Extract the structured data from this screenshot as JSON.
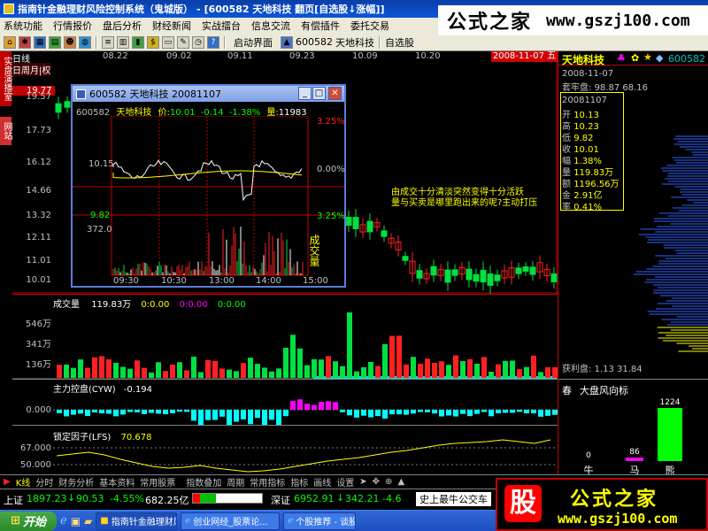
{
  "app": {
    "title": "指南针金融理财风险控制系统（鬼城版）",
    "title_sep": "-",
    "title_detail": "[600582 天地科技 翻页[自选股↓涨幅]]"
  },
  "watermark": {
    "cn": "公式之家",
    "url": "www.gszj100.com",
    "bottom_icon": "股"
  },
  "menu": [
    "系统功能",
    "行情报价",
    "盘后分析",
    "财经新闻",
    "实战擂台",
    "信息交流",
    "有偿插件",
    "委托交易"
  ],
  "toolbar": {
    "launch_label": "启动界面",
    "stock_code": "600582",
    "stock_name": "天地科技",
    "watchlist": "自选股"
  },
  "date_axis": {
    "labels": [
      "08.22",
      "09.02",
      "09.11",
      "09.23",
      "10.09",
      "10.20"
    ],
    "current_date": "2008-11-07",
    "current_day": "五"
  },
  "left_tabs": {
    "practice": "实盘演播室",
    "site": "网站"
  },
  "price_pane": {
    "period_label": "日线",
    "period_switch": "日周月|权",
    "highlight_price": "19.77",
    "price_ticks": [
      "19.57",
      "17.73",
      "16.12",
      "14.66",
      "13.32",
      "12.11",
      "11.01",
      "10.01"
    ],
    "annotation_line1": "由成交十分清淡突然变得十分活跃",
    "annotation_line2": "量与买卖是哪里跑出来的呢?主动打压"
  },
  "popup": {
    "title": "600582 天地科技 20081107",
    "code": "600582",
    "name": "天地科技",
    "price_label": "价:",
    "price": "10.01",
    "change": "-0.14",
    "change_pct": "-1.38%",
    "volume_label": "量:",
    "volume": "11983",
    "left_top": "10.15",
    "left_bottom": "9.82",
    "right_top": "3.25%",
    "right_mid": "0.00%",
    "right_bottom": "3.25%",
    "vol_max": "372.0",
    "vol_title": "成交量",
    "time_labels": [
      "09:30",
      "10:30",
      "13:00",
      "14:00",
      "15:00"
    ]
  },
  "volume_pane": {
    "title": "成交量",
    "value": "119.83万",
    "v1": "0:0.00",
    "v2": "0:0.00",
    "v3": "0:0.00",
    "ticks": [
      "546万",
      "341万",
      "136万"
    ]
  },
  "cyw_pane": {
    "title": "主力控盘(CYW)",
    "value": "-0.194",
    "tick": "0.000"
  },
  "lfs_pane": {
    "title": "锁定因子(LFS)",
    "value": "70.678",
    "ticks": [
      "67.000",
      "50.000"
    ]
  },
  "right_panel": {
    "name": "天地科技",
    "code": "600582",
    "date": "2008-11-07",
    "holding_label": "套牢盘:",
    "holding_value": "98.87 68.16",
    "quote_date": "20081107",
    "quotes": [
      {
        "label": "开",
        "value": "10.13"
      },
      {
        "label": "高",
        "value": "10.23"
      },
      {
        "label": "低",
        "value": "9.82"
      },
      {
        "label": "收",
        "value": "10.01"
      },
      {
        "label": "幅",
        "value": "1.38%"
      },
      {
        "label": "量",
        "value": "119.83万"
      },
      {
        "label": "额",
        "value": "1196.56万"
      },
      {
        "label": "金",
        "value": "2.91亿"
      },
      {
        "label": "率",
        "value": "0.41%"
      }
    ],
    "profit_label": "获利盘:",
    "profit_value": "1.13 31.84",
    "season": "春",
    "wind_label": "大盘风向标",
    "bars": [
      {
        "label": "牛",
        "value": "0"
      },
      {
        "label": "马",
        "value": "86"
      },
      {
        "label": "熊",
        "value": "1224"
      }
    ]
  },
  "bottom_tabs": [
    "K线",
    "分时",
    "财务分析",
    "基本资料",
    "常用股票",
    "指数叠加",
    "周期",
    "常用指标",
    "指标",
    "画线",
    "设置"
  ],
  "status": {
    "sh_label": "上证",
    "sh_index": "1897.23",
    "sh_change": "90.53",
    "sh_pct": "-4.55%",
    "sh_amount": "682.25亿",
    "sz_label": "深证",
    "sz_index": "6952.91",
    "sz_change": "342.21",
    "sz_pct": "-4.6",
    "scroll": "史上最牛公交车"
  },
  "taskbar": {
    "start": "开始",
    "items": [
      "指南针金融理财风...",
      "创业网经_股票论...",
      "个股推荐 - 谈股..."
    ]
  },
  "colors": {
    "up": "#ff2020",
    "down": "#00e040",
    "yellow": "#ffff00",
    "cyan": "#00ffff",
    "magenta": "#ff00ff",
    "axis_red": "#c00000"
  }
}
